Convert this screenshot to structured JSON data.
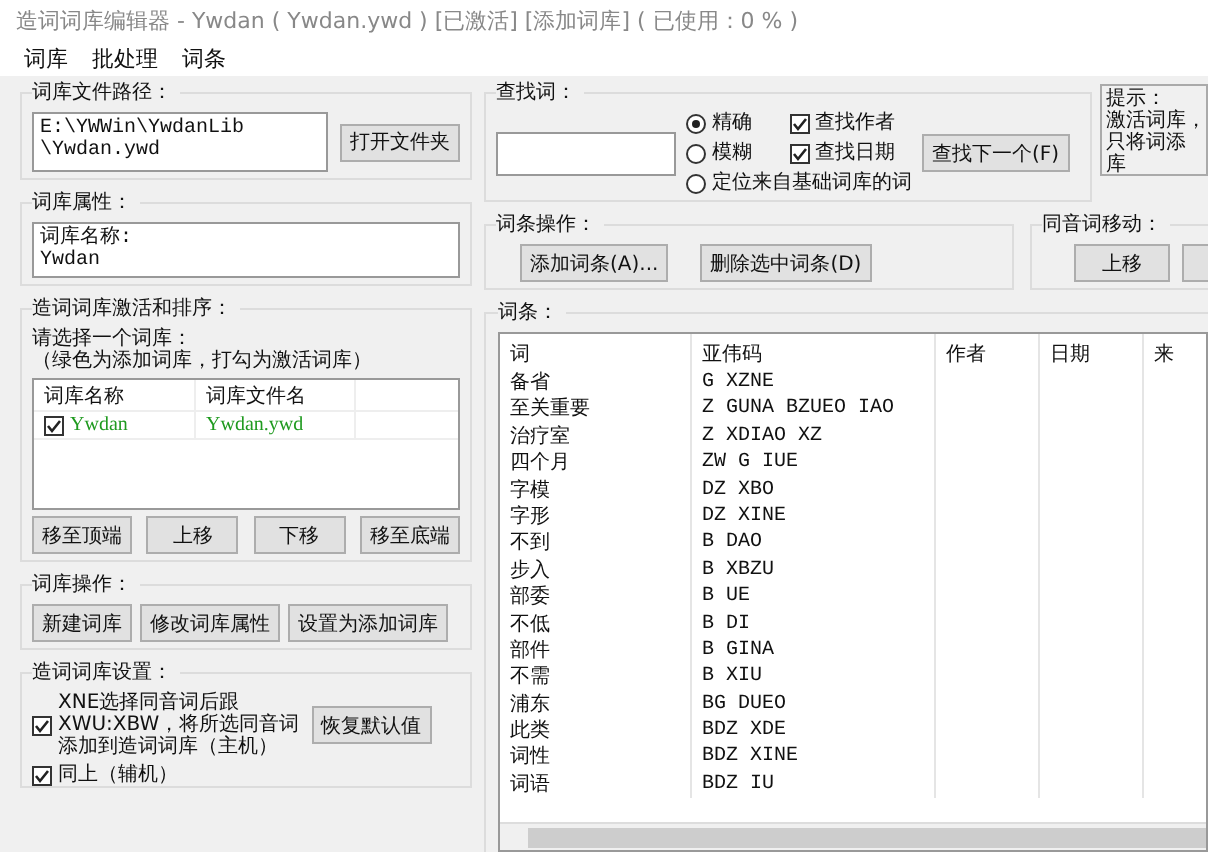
{
  "window": {
    "title": "造词词库编辑器 - Ywdan ( Ywdan.ywd ) [已激活] [添加词库] ( 已使用：0 % )"
  },
  "menu": [
    "词库",
    "批处理",
    "词条"
  ],
  "file_path": {
    "label": "词库文件路径：",
    "value": "E:\\YWWin\\YwdanLib\n\\Ywdan.ywd",
    "button": "打开文件夹"
  },
  "properties": {
    "label": "词库属性：",
    "value": "词库名称:\nYwdan"
  },
  "activation": {
    "label": "造词词库激活和排序：",
    "hint": [
      "请选择一个词库：",
      "（绿色为添加词库，打勾为激活词库）"
    ],
    "columns": [
      "词库名称",
      "词库文件名"
    ],
    "rows": [
      {
        "name": "Ywdan",
        "file": "Ywdan.ywd",
        "checked": true,
        "color": "#1f9a1f"
      }
    ],
    "buttons": [
      "移至顶端",
      "上移",
      "下移",
      "移至底端"
    ]
  },
  "library_ops": {
    "label": "词库操作：",
    "buttons": [
      "新建词库",
      "修改词库属性",
      "设置为添加词库"
    ]
  },
  "settings": {
    "label": "造词词库设置：",
    "options": [
      {
        "lines": [
          "XNE选择同音词后跟",
          "XWU:XBW，将所选同音词",
          "添加到造词词库（主机）"
        ],
        "checked": true
      },
      {
        "lines": [
          "同上（辅机）"
        ],
        "checked": true
      }
    ],
    "button": "恢复默认值"
  },
  "search": {
    "label": "查找词：",
    "modes": [
      {
        "label": "精确",
        "selected": true
      },
      {
        "label": "模糊",
        "selected": false
      },
      {
        "label": "定位来自基础词库的词",
        "selected": false
      }
    ],
    "filters": [
      {
        "label": "查找作者",
        "checked": true
      },
      {
        "label": "查找日期",
        "checked": true
      }
    ],
    "button": "查找下一个(F)",
    "tip": [
      "提示：",
      "激活词库，",
      "只将词添",
      "库"
    ]
  },
  "entry_ops": {
    "label": "词条操作：",
    "buttons": [
      "添加词条(A)...",
      "删除选中词条(D)"
    ]
  },
  "homophone_move": {
    "label": "同音词移动：",
    "button": "上移"
  },
  "entries": {
    "label": "词条：",
    "columns": [
      "词",
      "亚伟码",
      "作者",
      "日期",
      "来"
    ],
    "rows": [
      [
        "备省",
        "G XZNE"
      ],
      [
        "至关重要",
        "Z GUNA BZUEO IAO"
      ],
      [
        "治疗室",
        "Z XDIAO XZ"
      ],
      [
        "四个月",
        "ZW G IUE"
      ],
      [
        "字模",
        "DZ XBO"
      ],
      [
        "字形",
        "DZ XINE"
      ],
      [
        "不到",
        "B DAO"
      ],
      [
        "步入",
        "B XBZU"
      ],
      [
        "部委",
        "B UE"
      ],
      [
        "不低",
        "B DI"
      ],
      [
        "部件",
        "B GINA"
      ],
      [
        "不需",
        "B XIU"
      ],
      [
        "浦东",
        "BG DUEO"
      ],
      [
        "此类",
        "BDZ XDE"
      ],
      [
        "词性",
        "BDZ XINE"
      ],
      [
        "词语",
        "BDZ IU"
      ]
    ]
  }
}
